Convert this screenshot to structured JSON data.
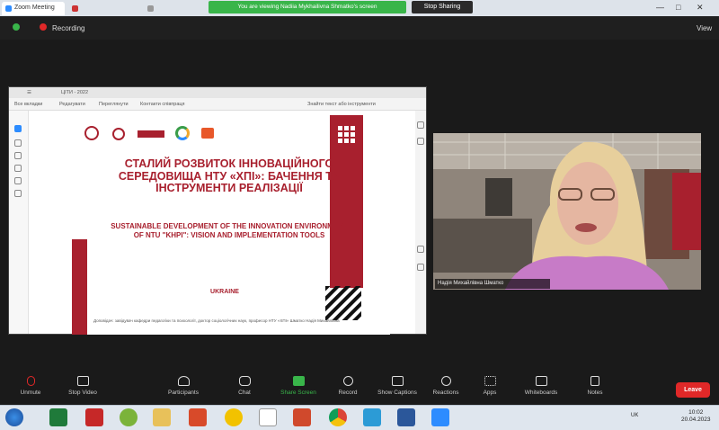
{
  "browser": {
    "tabs": [
      {
        "label": "Zoom Meeting",
        "active": true
      },
      {
        "label": "",
        "active": false
      },
      {
        "label": "",
        "active": false
      }
    ],
    "share_banner": "You are viewing Nadiia Mykhailivna Shmatko's screen",
    "stop_share_label": "Stop Sharing"
  },
  "recording": {
    "label": "Recording",
    "view_label": "View"
  },
  "pdf_viewer": {
    "tab_label": "ЦІТИ - 2022",
    "toolbar_items": [
      "Все вкладки",
      "Редагувати",
      "Переглянути",
      "Контакти співпраця"
    ],
    "search_placeholder": "Знайти текст або інструменти"
  },
  "slide": {
    "title_ua": "СТАЛИЙ РОЗВИТОК ІННОВАЦІЙНОГО СЕРЕДОВИЩА НТУ «ХПІ»: БАЧЕННЯ ТА ІНСТРУМЕНТИ РЕАЛІЗАЦІЇ",
    "title_en": "SUSTAINABLE DEVELOPMENT OF THE INNOVATION ENVIRONMENT OF NTU \"KHPI\": VISION AND IMPLEMENTATION TOOLS",
    "country": "UKRAINE",
    "footer": "Доповідач: завідувач кафедри педагогіки та психології, доктор соціологічних наук, професор НТУ «ХПІ» Шматко Надія Михайлівна"
  },
  "video": {
    "participant_name": "Надія Михайлівна Шматко"
  },
  "controls": [
    {
      "label": "Unmute",
      "icon": "mic-muted-icon"
    },
    {
      "label": "Stop Video",
      "icon": "video-icon"
    },
    {
      "label": "Participants",
      "icon": "participants-icon"
    },
    {
      "label": "Chat",
      "icon": "chat-icon"
    },
    {
      "label": "Share Screen",
      "icon": "share-screen-icon"
    },
    {
      "label": "Record",
      "icon": "record-icon"
    },
    {
      "label": "Show Captions",
      "icon": "captions-icon"
    },
    {
      "label": "Reactions",
      "icon": "reactions-icon"
    },
    {
      "label": "Apps",
      "icon": "apps-icon"
    },
    {
      "label": "Whiteboards",
      "icon": "whiteboard-icon"
    },
    {
      "label": "Notes",
      "icon": "notes-icon"
    }
  ],
  "leave_label": "Leave",
  "taskbar": {
    "lang": "UK",
    "time": "10:02",
    "date": "20.04.2023",
    "apps": [
      "start-icon",
      "excel-icon",
      "acrobat-icon",
      "viber-icon",
      "explorer-icon",
      "office-icon",
      "norton-icon",
      "anydesk-icon",
      "powerpoint-icon",
      "chrome-icon",
      "photos-icon",
      "word-icon",
      "zoom-icon"
    ]
  },
  "colors": {
    "accent_red": "#a8202e",
    "zoom_blue": "#2d8cff",
    "share_green": "#39b54a",
    "leave_red": "#e02828"
  }
}
